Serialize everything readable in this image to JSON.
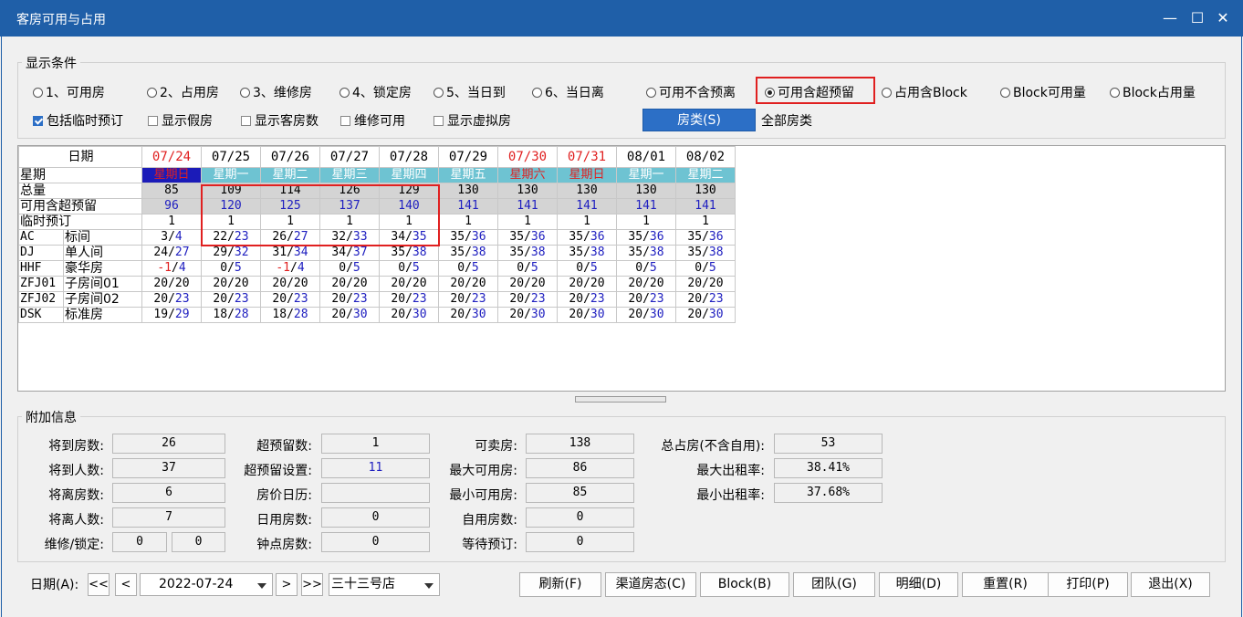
{
  "window": {
    "title": "客房可用与占用",
    "min": "—",
    "max": "☐",
    "close": "✕"
  },
  "filter": {
    "group_title": "显示条件",
    "radios_left": [
      "1、可用房",
      "2、占用房",
      "3、维修房",
      "4、锁定房",
      "5、当日到",
      "6、当日离"
    ],
    "radios_right": [
      "可用不含预离",
      "可用含超预留",
      "占用含Block",
      "Block可用量",
      "Block占用量"
    ],
    "selected_right": "可用含超预留",
    "checks": [
      {
        "label": "包括临时预订",
        "checked": true
      },
      {
        "label": "显示假房",
        "checked": false
      },
      {
        "label": "显示客房数",
        "checked": false
      },
      {
        "label": "维修可用",
        "checked": false
      },
      {
        "label": "显示虚拟房",
        "checked": false
      }
    ],
    "room_type_button": "房类(S)",
    "room_type_value": "全部房类"
  },
  "grid": {
    "date_header": "日期",
    "dates": [
      "07/24",
      "07/25",
      "07/26",
      "07/27",
      "07/28",
      "07/29",
      "07/30",
      "07/31",
      "08/01",
      "08/02"
    ],
    "weekday_label": "星期",
    "weekdays": [
      "星期日",
      "星期一",
      "星期二",
      "星期三",
      "星期四",
      "星期五",
      "星期六",
      "星期日",
      "星期一",
      "星期二"
    ],
    "total_label": "总量",
    "total": [
      "85",
      "109",
      "114",
      "126",
      "129",
      "130",
      "130",
      "130",
      "130",
      "130"
    ],
    "avail_label": "可用含超预留",
    "avail": [
      "96",
      "120",
      "125",
      "137",
      "140",
      "141",
      "141",
      "141",
      "141",
      "141"
    ],
    "temp_label": "临时预订",
    "temp": [
      "1",
      "1",
      "1",
      "1",
      "1",
      "1",
      "1",
      "1",
      "1",
      "1"
    ],
    "rooms": [
      {
        "code": "AC",
        "name": "标间",
        "a": [
          "3",
          "22",
          "26",
          "32",
          "34",
          "35",
          "35",
          "35",
          "35",
          "35"
        ],
        "b": [
          "4",
          "23",
          "27",
          "33",
          "35",
          "36",
          "36",
          "36",
          "36",
          "36"
        ]
      },
      {
        "code": "DJ",
        "name": "单人间",
        "a": [
          "24",
          "29",
          "31",
          "34",
          "35",
          "35",
          "35",
          "35",
          "35",
          "35"
        ],
        "b": [
          "27",
          "32",
          "34",
          "37",
          "38",
          "38",
          "38",
          "38",
          "38",
          "38"
        ]
      },
      {
        "code": "HHF",
        "name": "豪华房",
        "a": [
          "-1",
          "0",
          "-1",
          "0",
          "0",
          "0",
          "0",
          "0",
          "0",
          "0"
        ],
        "b": [
          "4",
          "5",
          "4",
          "5",
          "5",
          "5",
          "5",
          "5",
          "5",
          "5"
        ]
      },
      {
        "code": "ZFJ01",
        "name": "子房间01",
        "a": [
          "20",
          "20",
          "20",
          "20",
          "20",
          "20",
          "20",
          "20",
          "20",
          "20"
        ],
        "b": [
          "20",
          "20",
          "20",
          "20",
          "20",
          "20",
          "20",
          "20",
          "20",
          "20"
        ]
      },
      {
        "code": "ZFJ02",
        "name": "子房间02",
        "a": [
          "20",
          "20",
          "20",
          "20",
          "20",
          "20",
          "20",
          "20",
          "20",
          "20"
        ],
        "b": [
          "23",
          "23",
          "23",
          "23",
          "23",
          "23",
          "23",
          "23",
          "23",
          "23"
        ]
      },
      {
        "code": "DSK",
        "name": "标准房",
        "a": [
          "19",
          "18",
          "18",
          "20",
          "20",
          "20",
          "20",
          "20",
          "20",
          "20"
        ],
        "b": [
          "29",
          "28",
          "28",
          "30",
          "30",
          "30",
          "30",
          "30",
          "30",
          "30"
        ]
      }
    ]
  },
  "info": {
    "group_title": "附加信息",
    "arrive_rooms_label": "将到房数:",
    "arrive_rooms": "26",
    "arrive_people_label": "将到人数:",
    "arrive_people": "37",
    "depart_rooms_label": "将离房数:",
    "depart_rooms": "6",
    "depart_people_label": "将离人数:",
    "depart_people": "7",
    "maint_lock_label": "维修/锁定:",
    "maint": "0",
    "lock": "0",
    "overbook_label": "超预留数:",
    "overbook": "1",
    "overbook_set_label": "超预留设置:",
    "overbook_set": "11",
    "rate_calendar_label": "房价日历:",
    "rate_calendar": "",
    "dayuse_label": "日用房数:",
    "dayuse": "0",
    "hourly_label": "钟点房数:",
    "hourly": "0",
    "sellable_label": "可卖房:",
    "sellable": "138",
    "max_avail_label": "最大可用房:",
    "max_avail": "86",
    "min_avail_label": "最小可用房:",
    "min_avail": "85",
    "self_use_label": "自用房数:",
    "self_use": "0",
    "waiting_label": "等待预订:",
    "waiting": "0",
    "total_occ_label": "总占房(不含自用):",
    "total_occ": "53",
    "max_occ_label": "最大出租率:",
    "max_occ": "38.41%",
    "min_occ_label": "最小出租率:",
    "min_occ": "37.68%"
  },
  "footer": {
    "date_label": "日期(A):",
    "first": "<<",
    "prev": "<",
    "next": ">",
    "last": ">>",
    "date_value": "2022-07-24",
    "hotel": "三十三号店",
    "buttons": [
      "刷新(F)",
      "渠道房态(C)",
      "Block(B)",
      "团队(G)",
      "明细(D)",
      "重置(R)",
      "打印(P)",
      "退出(X)"
    ]
  }
}
